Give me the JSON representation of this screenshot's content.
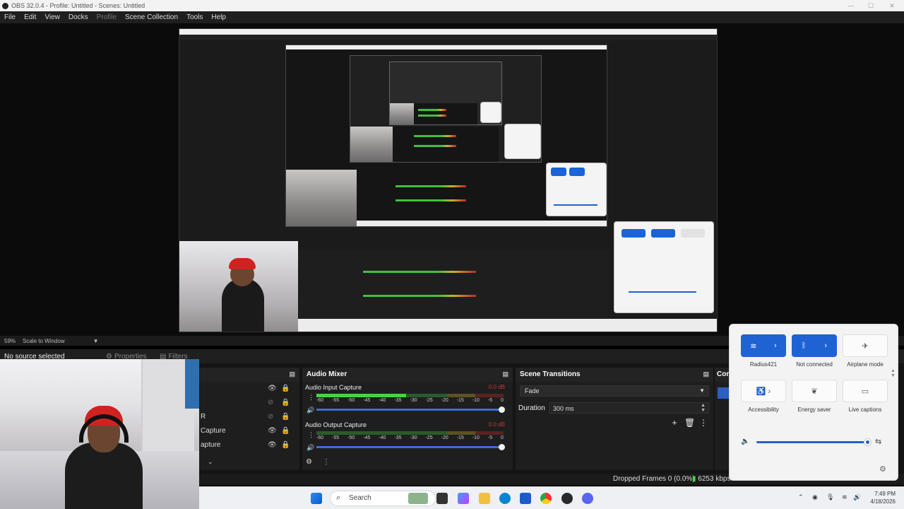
{
  "window": {
    "title": "OBS 32.0.4 - Profile: Untitled - Scenes: Untitled",
    "min": "—",
    "max": "☐",
    "close": "✕"
  },
  "menu": [
    "File",
    "Edit",
    "View",
    "Docks",
    "Profile",
    "Scene Collection",
    "Tools",
    "Help"
  ],
  "zoom": {
    "level": "59%",
    "mode": "Scale to Window"
  },
  "source_bar": {
    "no_source": "No source selected",
    "properties": "Properties",
    "filters": "Filters"
  },
  "sources": {
    "items": [
      {
        "name": ""
      },
      {
        "name": ""
      },
      {
        "name": "R"
      },
      {
        "name": "Capture"
      },
      {
        "name": "apture"
      }
    ]
  },
  "audio_mixer": {
    "title": "Audio Mixer",
    "scale": [
      "-60",
      "-55",
      "-50",
      "-45",
      "-40",
      "-35",
      "-30",
      "-25",
      "-20",
      "-15",
      "-10",
      "-5",
      "0"
    ],
    "channels": [
      {
        "name": "Audio Input Capture",
        "db": "0.0 dB",
        "level": 0.48
      },
      {
        "name": "Audio Output Capture",
        "db": "0.0 dB",
        "level": 0.0
      }
    ]
  },
  "scene_transitions": {
    "title": "Scene Transitions",
    "selected": "Fade",
    "duration_label": "Duration",
    "duration_value": "300 ms"
  },
  "controls_partial": "Con",
  "status": {
    "dropped": "Dropped Frames 0 (0.0%)",
    "bitrate": "6253 kbps"
  },
  "taskbar": {
    "search": "Search",
    "time": "7:49 PM",
    "date": "4/18/2026"
  },
  "quick_settings": {
    "tiles": [
      {
        "label": "Radius421",
        "on": true
      },
      {
        "label": "Not connected",
        "on": true
      },
      {
        "label": "Airplane mode",
        "on": false
      },
      {
        "label": "Accessibility",
        "on": false
      },
      {
        "label": "Energy saver",
        "on": false
      },
      {
        "label": "Live captions",
        "on": false
      }
    ],
    "volume": 0.95
  }
}
